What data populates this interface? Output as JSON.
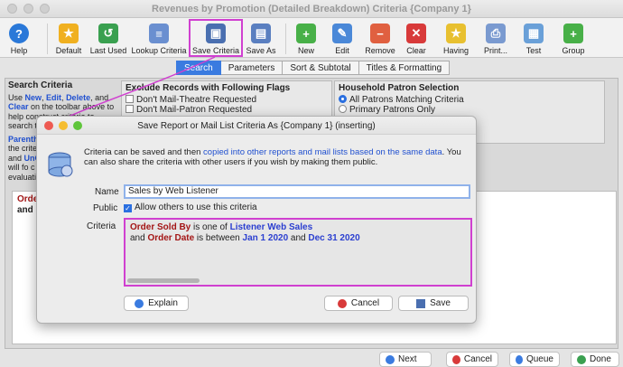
{
  "window": {
    "title": "Revenues by Promotion (Detailed Breakdown) Criteria {Company 1}"
  },
  "toolbar": {
    "items": [
      "Help",
      "Default",
      "Last Used",
      "Lookup Criteria",
      "Save Criteria",
      "Save As",
      "New",
      "Edit",
      "Remove",
      "Clear",
      "Having",
      "Print...",
      "Test",
      "Group"
    ]
  },
  "tabs": [
    "Search",
    "Parameters",
    "Sort & Subtotal",
    "Titles & Formatting"
  ],
  "search_criteria": {
    "title": "Search Criteria",
    "l1": "Use ",
    "new": "New",
    ", ": ", ",
    "edit": "Edit",
    "delete": "Delete",
    ", and": ", and",
    "clear": "Clear",
    "l2": " on the toolbar above to",
    "l3": "help construct criteria to",
    "l4": "search th",
    "parent": "Parenth",
    "l5": "the crite",
    "and_l": "and ",
    "unc": "UnC",
    "l6": "will fo c",
    "l7": "evaluati"
  },
  "exclude": {
    "title": "Exclude Records with Following Flags",
    "items": [
      "Don't Mail-Theatre Requested",
      "Don't Mail-Patron Requested"
    ]
  },
  "household": {
    "title": "Household Patron Selection",
    "options": [
      "All Patrons Matching Criteria",
      "Primary Patrons Only"
    ],
    "selected": 0
  },
  "criteria_bg": {
    "l1": "Order",
    "l2a": "and ",
    "l2b": "Or"
  },
  "dialog": {
    "title": "Save Report or Mail List Criteria As {Company 1} (inserting)",
    "desc_a": "Criteria can be saved and then ",
    "desc_link": "copied into other reports and mail lists based on the same data",
    "desc_b": ".  You can also share the criteria with other users if you wish by making them public.",
    "name_label": "Name",
    "name_value": "Sales by Web Listener",
    "public_label": "Public",
    "public_checkbox": "Allow others to use this criteria",
    "public_checked": true,
    "criteria_label": "Criteria",
    "c1_kw": "Order Sold By",
    "c1_mid": " is one of ",
    "c1_val": "Listener Web Sales",
    "c2_a": "and ",
    "c2_kw": "Order Date",
    "c2_mid": " is between ",
    "c2_v1": "Jan 1 2020",
    "c2_and": " and ",
    "c2_v2": "Dec 31 2020",
    "explain": "Explain",
    "cancel": "Cancel",
    "save": "Save"
  },
  "bottom": {
    "next": "Next",
    "cancel": "Cancel",
    "queue": "Queue",
    "done": "Done"
  }
}
